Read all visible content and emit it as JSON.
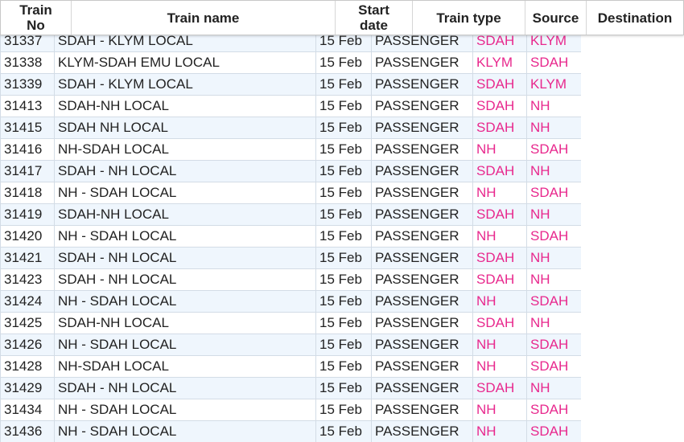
{
  "table": {
    "columns": [
      "Train\nNo",
      "Train name",
      "Start\ndate",
      "Train type",
      "Source",
      "Destination"
    ],
    "rows": [
      [
        "31337",
        "SDAH - KLYM LOCAL",
        "15 Feb",
        "PASSENGER",
        "SDAH",
        "KLYM"
      ],
      [
        "31338",
        "KLYM-SDAH EMU LOCAL",
        "15 Feb",
        "PASSENGER",
        "KLYM",
        "SDAH"
      ],
      [
        "31339",
        "SDAH - KLYM LOCAL",
        "15 Feb",
        "PASSENGER",
        "SDAH",
        "KLYM"
      ],
      [
        "31413",
        "SDAH-NH LOCAL",
        "15 Feb",
        "PASSENGER",
        "SDAH",
        "NH"
      ],
      [
        "31415",
        "SDAH NH LOCAL",
        "15 Feb",
        "PASSENGER",
        "SDAH",
        "NH"
      ],
      [
        "31416",
        "NH-SDAH LOCAL",
        "15 Feb",
        "PASSENGER",
        "NH",
        "SDAH"
      ],
      [
        "31417",
        "SDAH - NH LOCAL",
        "15 Feb",
        "PASSENGER",
        "SDAH",
        "NH"
      ],
      [
        "31418",
        "NH - SDAH LOCAL",
        "15 Feb",
        "PASSENGER",
        "NH",
        "SDAH"
      ],
      [
        "31419",
        "SDAH-NH LOCAL",
        "15 Feb",
        "PASSENGER",
        "SDAH",
        "NH"
      ],
      [
        "31420",
        "NH - SDAH LOCAL",
        "15 Feb",
        "PASSENGER",
        "NH",
        "SDAH"
      ],
      [
        "31421",
        "SDAH - NH LOCAL",
        "15 Feb",
        "PASSENGER",
        "SDAH",
        "NH"
      ],
      [
        "31423",
        "SDAH - NH LOCAL",
        "15 Feb",
        "PASSENGER",
        "SDAH",
        "NH"
      ],
      [
        "31424",
        "NH - SDAH LOCAL",
        "15 Feb",
        "PASSENGER",
        "NH",
        "SDAH"
      ],
      [
        "31425",
        "SDAH-NH LOCAL",
        "15 Feb",
        "PASSENGER",
        "SDAH",
        "NH"
      ],
      [
        "31426",
        "NH - SDAH LOCAL",
        "15 Feb",
        "PASSENGER",
        "NH",
        "SDAH"
      ],
      [
        "31428",
        "NH-SDAH LOCAL",
        "15 Feb",
        "PASSENGER",
        "NH",
        "SDAH"
      ],
      [
        "31429",
        "SDAH - NH LOCAL",
        "15 Feb",
        "PASSENGER",
        "SDAH",
        "NH"
      ],
      [
        "31434",
        "NH - SDAH LOCAL",
        "15 Feb",
        "PASSENGER",
        "NH",
        "SDAH"
      ],
      [
        "31436",
        "NH - SDAH LOCAL",
        "15 Feb",
        "PASSENGER",
        "NH",
        "SDAH"
      ]
    ]
  },
  "colors": {
    "station_link": "#e8288d",
    "row_alt_bg": "#eff6fd",
    "border": "#d3dce6"
  }
}
